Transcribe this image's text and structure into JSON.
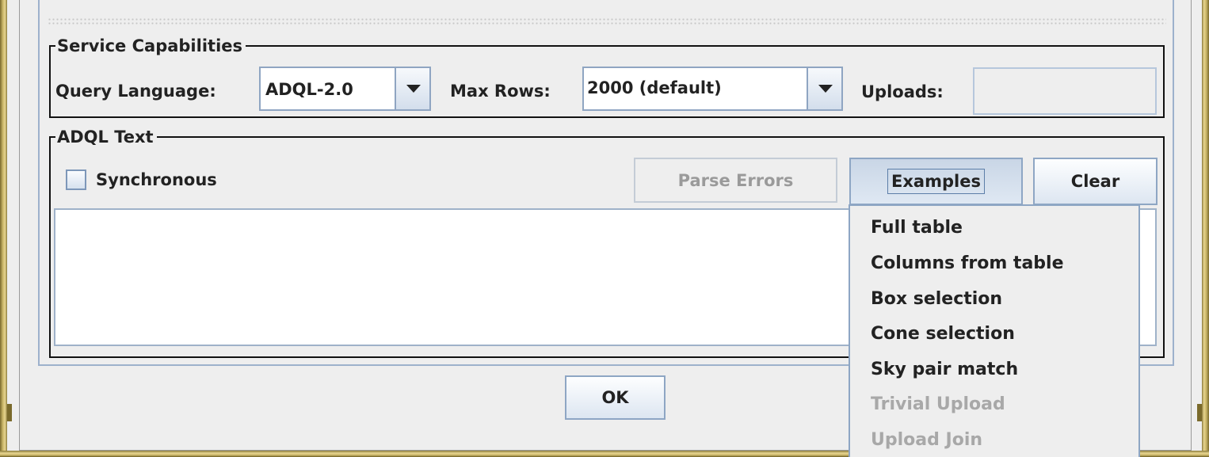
{
  "service_capabilities": {
    "title": "Service Capabilities",
    "query_language_label": "Query Language:",
    "query_language_value": "ADQL-2.0",
    "max_rows_label": "Max Rows:",
    "max_rows_value": "2000 (default)",
    "uploads_label": "Uploads:",
    "uploads_value": ""
  },
  "adql_text": {
    "title": "ADQL Text",
    "synchronous_label": "Synchronous",
    "synchronous_checked": false,
    "parse_errors_label": "Parse Errors",
    "examples_label": "Examples",
    "clear_label": "Clear",
    "query_text": ""
  },
  "examples_menu": {
    "items": [
      {
        "label": "Full table",
        "enabled": true
      },
      {
        "label": "Columns from table",
        "enabled": true
      },
      {
        "label": "Box selection",
        "enabled": true
      },
      {
        "label": "Cone selection",
        "enabled": true
      },
      {
        "label": "Sky pair match",
        "enabled": true
      },
      {
        "label": "Trivial Upload",
        "enabled": false
      },
      {
        "label": "Upload Join",
        "enabled": false
      }
    ]
  },
  "dialog": {
    "ok_label": "OK"
  },
  "colors": {
    "window_frame": "#cbb76a",
    "button_border": "#8ea6c4",
    "disabled_text": "#a8a8a8"
  }
}
